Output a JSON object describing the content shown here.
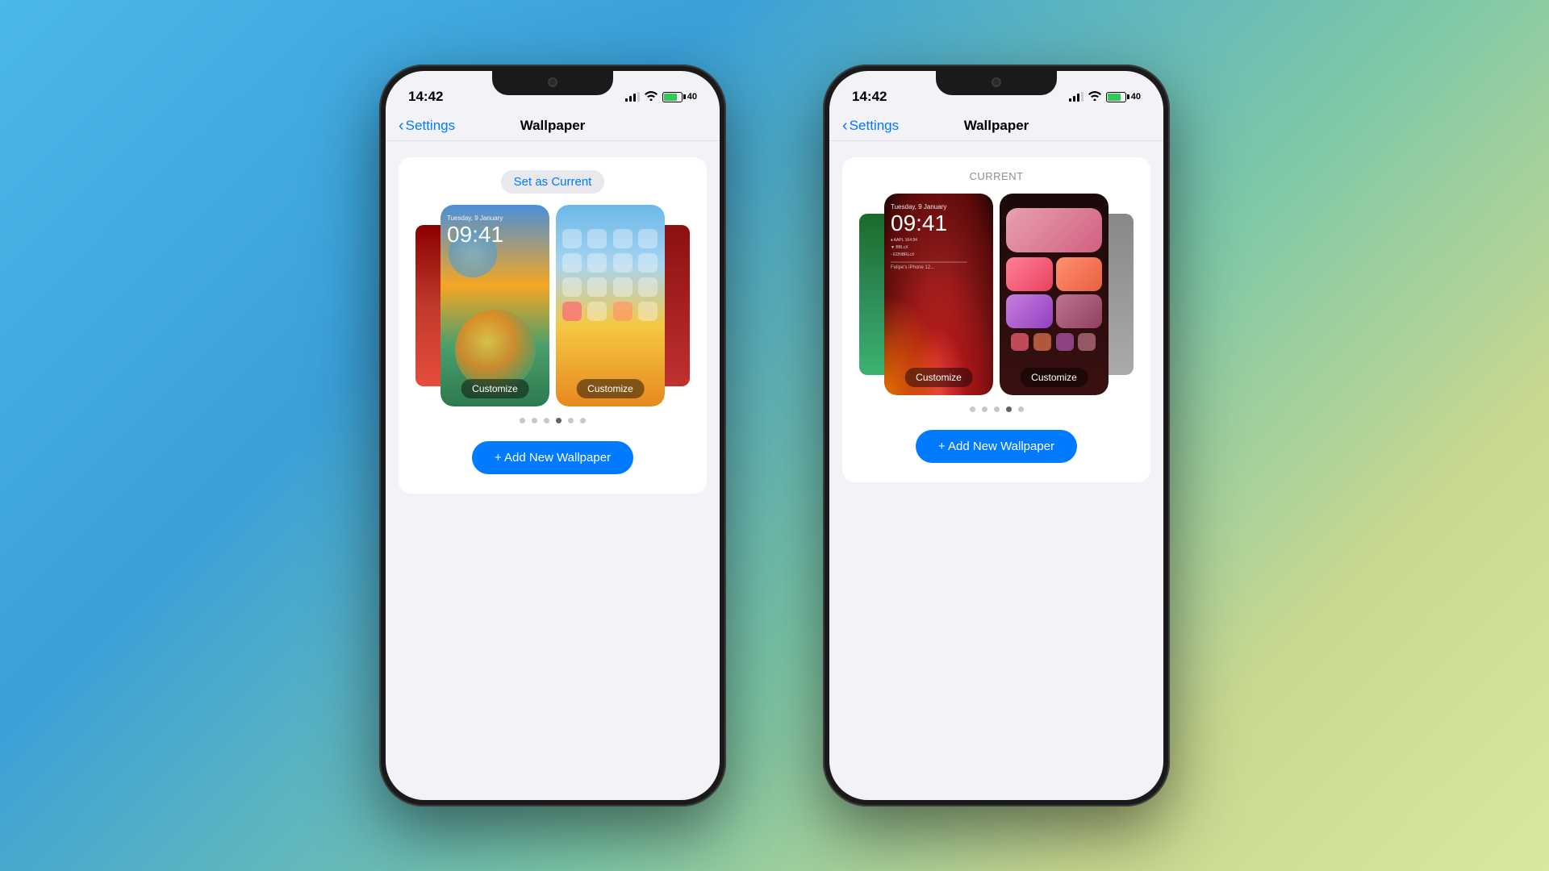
{
  "background": {
    "gradient_start": "#4ab8e8",
    "gradient_end": "#d8e8a0"
  },
  "phone_left": {
    "status_bar": {
      "time": "14:42",
      "battery_text": "40"
    },
    "nav": {
      "back_label": "Settings",
      "title": "Wallpaper"
    },
    "wallpaper_section": {
      "badge_label": "Set as Current",
      "customize_lock": "Customize",
      "customize_home": "Customize",
      "add_button": "+ Add New Wallpaper"
    },
    "page_dots": [
      false,
      false,
      false,
      true,
      false,
      false
    ],
    "lock_date": "Tuesday, 9 January",
    "lock_time": "09:41"
  },
  "phone_right": {
    "status_bar": {
      "time": "14:42",
      "battery_text": "40"
    },
    "nav": {
      "back_label": "Settings",
      "title": "Wallpaper"
    },
    "wallpaper_section": {
      "current_label": "CURRENT",
      "customize_lock": "Customize",
      "customize_home": "Customize",
      "add_button": "+ Add New Wallpaper"
    },
    "page_dots": [
      false,
      false,
      false,
      true,
      false
    ],
    "lock_date": "Tuesday, 9 January",
    "lock_time": "09:41"
  }
}
